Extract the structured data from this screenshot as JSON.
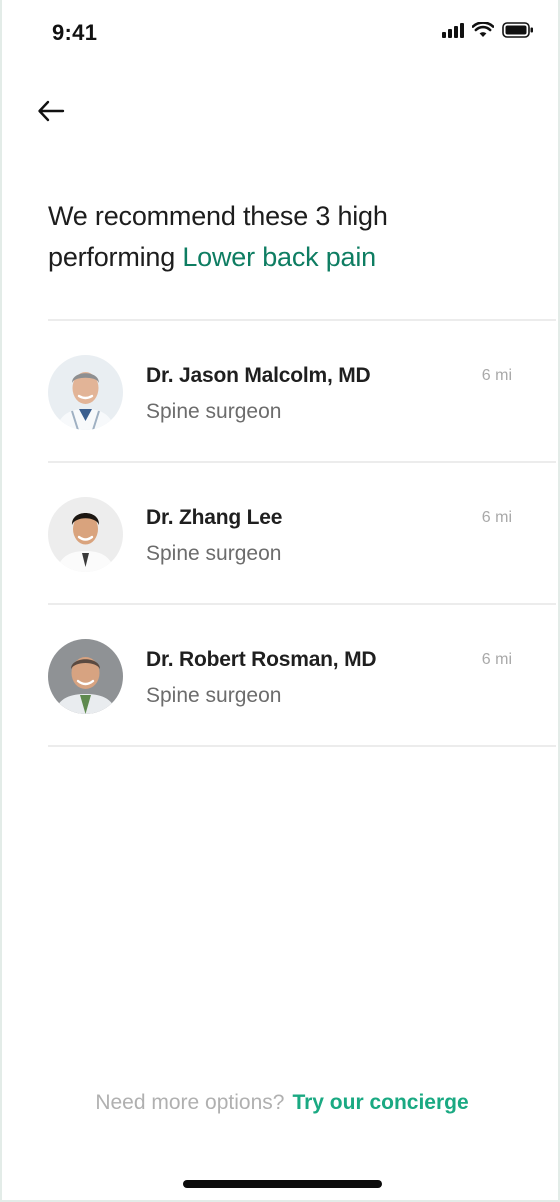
{
  "status_bar": {
    "time": "9:41"
  },
  "header": {
    "headline_prefix": "We recommend these 3 high performing ",
    "headline_accent": "Lower back pain"
  },
  "doctors": [
    {
      "name": "Dr. Jason Malcolm, MD",
      "specialty": "Spine surgeon",
      "distance": "6 mi"
    },
    {
      "name": "Dr. Zhang Lee",
      "specialty": "Spine surgeon",
      "distance": "6 mi"
    },
    {
      "name": "Dr. Robert Rosman, MD",
      "specialty": "Spine surgeon",
      "distance": "6 mi"
    }
  ],
  "footer": {
    "prompt": "Need more options?",
    "cta_label": "Try our concierge"
  },
  "colors": {
    "accent": "#0e7d62",
    "cta": "#1aa982"
  }
}
